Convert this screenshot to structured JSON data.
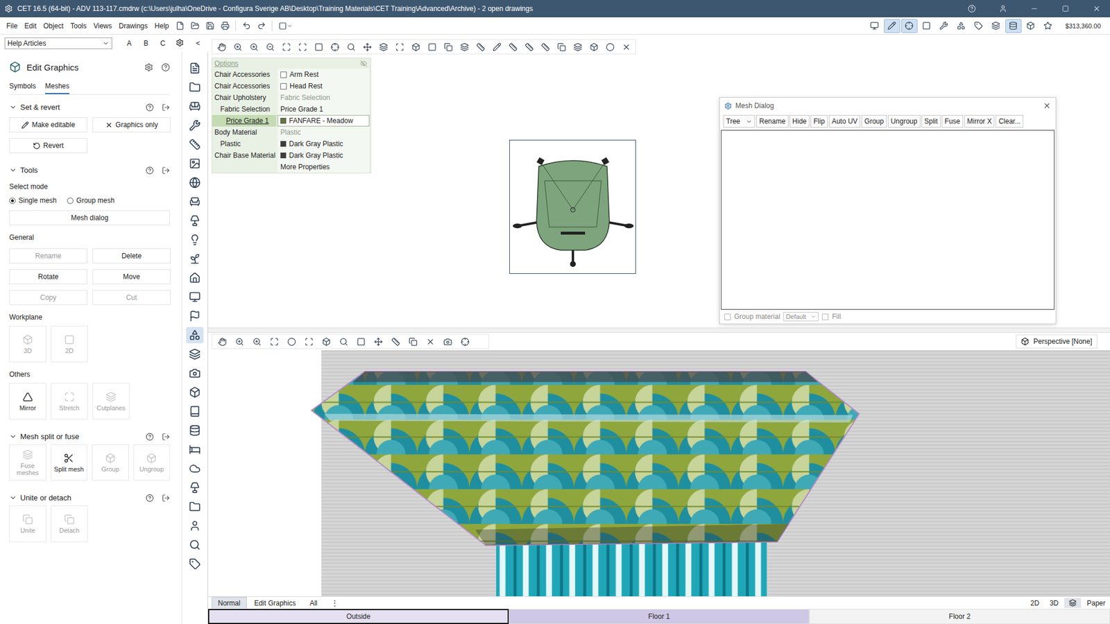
{
  "window": {
    "title": "CET 16.5 (64-bit) - ADV 113-117.cmdrw (c:\\Users\\julha\\OneDrive - Configura Sverige AB\\Desktop\\Training Materials\\CET Training\\Advanced\\Archive) - 2  open drawings"
  },
  "menu": [
    "File",
    "Edit",
    "Object",
    "Tools",
    "Views",
    "Drawings",
    "Help"
  ],
  "right_tools": [
    {
      "selected": false
    },
    {
      "selected": true
    },
    {
      "selected": true
    },
    {
      "selected": false
    },
    {
      "selected": false
    },
    {
      "selected": false
    },
    {
      "selected": false
    },
    {
      "selected": false
    },
    {
      "selected": true
    },
    {
      "selected": false
    },
    {
      "selected": false
    }
  ],
  "price": "$313,360.00",
  "help_row": {
    "dropdown": "Help Articles",
    "letters": [
      "A",
      "B",
      "C"
    ],
    "collapse": "<"
  },
  "panel": {
    "title": "Edit Graphics",
    "tabs": [
      {
        "label": "Symbols",
        "selected": false
      },
      {
        "label": "Meshes",
        "selected": true
      }
    ],
    "set_revert": {
      "title": "Set & revert",
      "expanded": true,
      "buttons": [
        {
          "label": "Make editable",
          "disabled": false
        },
        {
          "label": "Graphics only",
          "disabled": false
        },
        {
          "label": "Revert",
          "disabled": false
        }
      ]
    },
    "tools": {
      "title": "Tools",
      "expanded": true,
      "select_mode": "Select mode",
      "modes": [
        {
          "label": "Single mesh",
          "selected": true
        },
        {
          "label": "Group mesh",
          "selected": false
        }
      ],
      "mesh_dialog": "Mesh dialog",
      "general": "General",
      "general_buttons": [
        {
          "label": "Rename",
          "disabled": true
        },
        {
          "label": "Delete",
          "disabled": false
        },
        {
          "label": "Rotate",
          "disabled": false
        },
        {
          "label": "Move",
          "disabled": false
        },
        {
          "label": "Copy",
          "disabled": true
        },
        {
          "label": "Cut",
          "disabled": true
        }
      ],
      "workplane": "Workplane",
      "workplane_tiles": [
        {
          "label": "3D",
          "disabled": true
        },
        {
          "label": "2D",
          "disabled": true
        }
      ],
      "others": "Others",
      "others_tiles": [
        {
          "label": "Mirror",
          "disabled": false
        },
        {
          "label": "Stretch",
          "disabled": true
        },
        {
          "label": "Cutplanes",
          "disabled": true
        }
      ]
    },
    "split_fuse": {
      "title": "Mesh split or fuse",
      "expanded": true,
      "tiles": [
        {
          "label": "Fuse meshes",
          "disabled": true
        },
        {
          "label": "Split mesh",
          "disabled": false
        },
        {
          "label": "Group",
          "disabled": true
        },
        {
          "label": "Ungroup",
          "disabled": true
        }
      ]
    },
    "unite_detach": {
      "title": "Unite or detach",
      "expanded": true,
      "tiles": [
        {
          "label": "Unite",
          "disabled": true
        },
        {
          "label": "Detach",
          "disabled": true
        }
      ]
    }
  },
  "sidebar_icons": [
    {
      "selected": false
    },
    {
      "selected": false
    },
    {
      "selected": false
    },
    {
      "selected": false
    },
    {
      "selected": false
    },
    {
      "selected": false
    },
    {
      "selected": false
    },
    {
      "selected": false
    },
    {
      "selected": false
    },
    {
      "selected": false
    },
    {
      "selected": false
    },
    {
      "selected": false
    },
    {
      "selected": false
    },
    {
      "selected": false
    },
    {
      "selected": true
    },
    {
      "selected": false
    },
    {
      "selected": false
    },
    {
      "selected": false
    },
    {
      "selected": false
    },
    {
      "selected": false
    },
    {
      "selected": false
    },
    {
      "selected": false
    },
    {
      "selected": false
    },
    {
      "selected": false
    },
    {
      "selected": false
    },
    {
      "selected": false
    },
    {
      "selected": false
    }
  ],
  "options": {
    "header": "Options",
    "rows": [
      {
        "label": "Chair Accessories",
        "depth": 0,
        "selected": false,
        "kind": "checkbox",
        "value": "Arm Rest",
        "checked": false
      },
      {
        "label": "Chair Accessories",
        "depth": 0,
        "selected": false,
        "kind": "checkbox",
        "value": "Head Rest",
        "checked": false
      },
      {
        "label": "Chair Upholstery",
        "depth": 0,
        "selected": false,
        "kind": "group",
        "value": "Fabric Selection"
      },
      {
        "label": "Fabric Selection",
        "depth": 1,
        "selected": false,
        "kind": "text",
        "value": "Price Grade 1"
      },
      {
        "label": "Price Grade 1",
        "depth": 2,
        "selected": true,
        "kind": "swatch",
        "value": "FANFARE - Meadow",
        "color": "#5f7a3a"
      },
      {
        "label": "Body Material",
        "depth": 0,
        "selected": false,
        "kind": "group",
        "value": "Plastic"
      },
      {
        "label": "Plastic",
        "depth": 1,
        "selected": false,
        "kind": "swatch",
        "value": "Dark Gray Plastic",
        "color": "#3c3c3c"
      },
      {
        "label": "Chair Base Material",
        "depth": 0,
        "selected": false,
        "kind": "swatch",
        "value": "Dark Gray Plastic",
        "color": "#3c3c3c"
      }
    ],
    "more": "More Properties"
  },
  "mesh_dialog": {
    "title": "Mesh Dialog",
    "view": "Tree",
    "tools": [
      "Rename",
      "Hide",
      "Flip",
      "Auto UV",
      "Group",
      "Ungroup",
      "Split",
      "Fuse",
      "Mirror X",
      "Clear..."
    ],
    "group_material": {
      "label": "Group material",
      "checked": false,
      "disabled": true
    },
    "material": {
      "value": "Default",
      "disabled": true
    },
    "fill": {
      "label": "Fill",
      "checked": false,
      "disabled": true
    }
  },
  "perspective": "Perspective [None]",
  "view_tabs": [
    {
      "label": "Normal",
      "selected": true
    },
    {
      "label": "Edit Graphics",
      "selected": false
    },
    {
      "label": "All",
      "selected": false
    }
  ],
  "view_tabs_more": "⋮",
  "view_modes": [
    {
      "label": "2D",
      "selected": false
    },
    {
      "label": "3D",
      "selected": false
    }
  ],
  "split_view_selected": true,
  "paper": "Paper",
  "floors": [
    {
      "label": "Outside",
      "selected": true,
      "current": false
    },
    {
      "label": "Floor 1",
      "selected": false,
      "current": true
    },
    {
      "label": "Floor 2",
      "selected": false,
      "current": false
    }
  ]
}
